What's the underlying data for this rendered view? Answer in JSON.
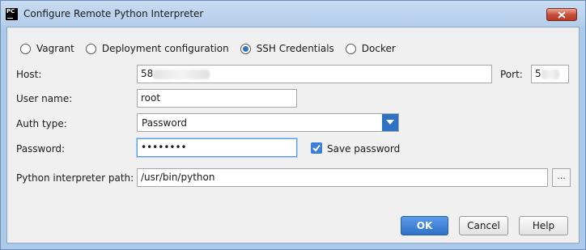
{
  "window": {
    "title": "Configure Remote Python Interpreter",
    "app_icon_text": "PC"
  },
  "connection_types": [
    {
      "label": "Vagrant",
      "checked": false
    },
    {
      "label": "Deployment configuration",
      "checked": false
    },
    {
      "label": "SSH Credentials",
      "checked": true
    },
    {
      "label": "Docker",
      "checked": false
    }
  ],
  "form": {
    "host_label": "Host:",
    "host_value": "58",
    "port_label": "Port:",
    "port_value": "5",
    "username_label": "User name:",
    "username_value": "root",
    "auth_type_label": "Auth type:",
    "auth_type_value": "Password",
    "password_label": "Password:",
    "password_value": "••••••••",
    "save_password_label": "Save password",
    "save_password_checked": true,
    "interpreter_path_label": "Python interpreter path:",
    "interpreter_path_value": "/usr/bin/python",
    "browse_label": "..."
  },
  "buttons": {
    "ok": "OK",
    "cancel": "Cancel",
    "help": "Help"
  }
}
